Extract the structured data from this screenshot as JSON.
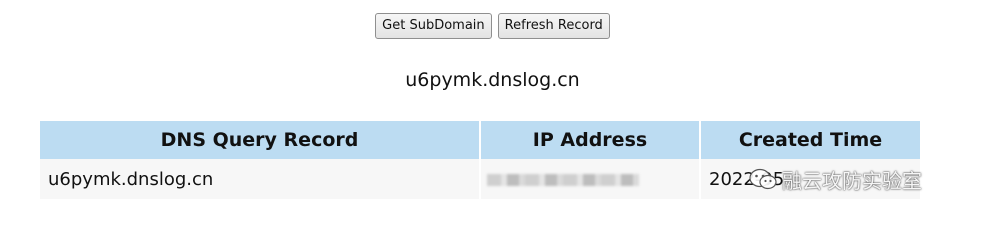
{
  "toolbar": {
    "get_subdomain_label": "Get SubDomain",
    "refresh_record_label": "Refresh Record"
  },
  "subdomain": "u6pymk.dnslog.cn",
  "table": {
    "headers": [
      "DNS Query Record",
      "IP Address",
      "Created Time"
    ],
    "rows": [
      {
        "dns_query_record": "u6pymk.dnslog.cn",
        "ip_address": "",
        "created_time": "2022-05"
      }
    ]
  },
  "watermark": {
    "icon": "wechat-icon",
    "text": "融云攻防实验室"
  },
  "colors": {
    "header_bg": "#bcdcf2",
    "row_bg": "#f7f7f7"
  }
}
